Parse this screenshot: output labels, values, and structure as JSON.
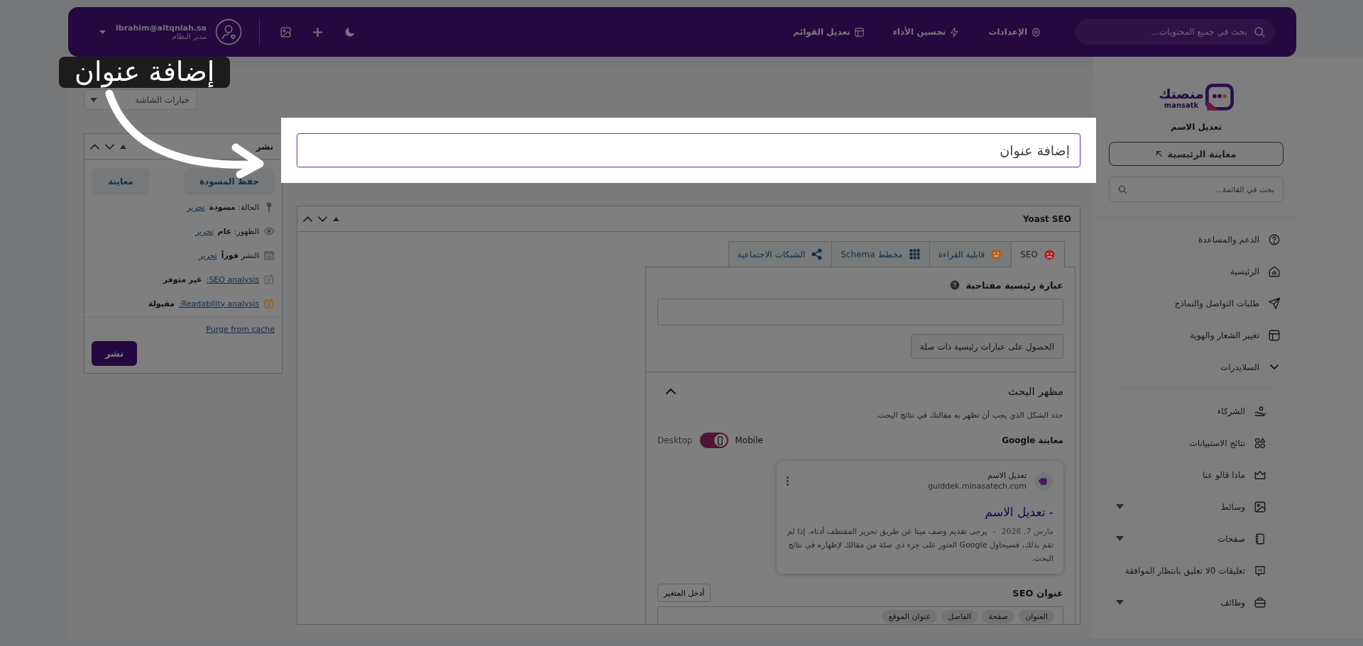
{
  "topbar": {
    "search": {
      "placeholder": "بحث في جميع المحتويات..."
    },
    "nav": [
      {
        "label": "الإعدادات"
      },
      {
        "label": "تحسين الأداء"
      },
      {
        "label": "تعديل القوائم"
      }
    ],
    "user": {
      "email": "ibrahim@altqniah.sa",
      "role": "مدير النظام"
    }
  },
  "sidebar": {
    "logo": {
      "name": "منصتك",
      "latin": "mansatk"
    },
    "site_name": "تعديل الاسم",
    "preview_button": "معاينة الرئيسية",
    "search": {
      "placeholder": "بحث في القائمة..."
    },
    "groups": [
      {
        "items": [
          {
            "label": "الدعم والمساعدة",
            "kind": "link"
          },
          {
            "label": "الرئيسية",
            "kind": "link"
          },
          {
            "label": "طلبات التواصل والنماذج",
            "kind": "link"
          },
          {
            "label": "تغيير الشعار والهوية",
            "kind": "link"
          },
          {
            "label": "السلايدرات",
            "kind": "link"
          }
        ]
      },
      {
        "items": [
          {
            "label": "الشركاء",
            "kind": "link"
          },
          {
            "label": "نتائج الاستبيانات",
            "kind": "link"
          },
          {
            "label": "ماذا قالو عنا",
            "kind": "link"
          },
          {
            "label": "وسائط",
            "kind": "submenu"
          },
          {
            "label": "صفحات",
            "kind": "submenu"
          },
          {
            "label": "تعليقات 0لا تعليق بانتظار الموافقة",
            "kind": "link"
          },
          {
            "label": "وظائف",
            "kind": "submenu"
          }
        ]
      }
    ]
  },
  "screen_options": {
    "label": "خيارات الشاشة"
  },
  "title_field": {
    "placeholder": "إضافة عنوان"
  },
  "tooltip": {
    "text": "إضافة عنوان"
  },
  "publish": {
    "title": "نشر",
    "save_draft": "حفظ المسودة",
    "preview": "معاينة",
    "rows": [
      {
        "kind": "meta",
        "text": "الحالة: **مسودة**",
        "link": "تحرير"
      },
      {
        "kind": "meta",
        "text": "الظهور: **عام**",
        "link": "تحرير"
      },
      {
        "kind": "meta",
        "text": "النشر **فوراً**",
        "link": "تحرير"
      },
      {
        "kind": "analysis",
        "link": "SEO analysis:",
        "value": "غير متوفر",
        "color": "#5a5c60"
      },
      {
        "kind": "analysis",
        "link": "Readability analysis:",
        "value": "مقبولة",
        "color": "#a3560f"
      }
    ],
    "purge_link": "Purge from cache",
    "publish_button": "نشر"
  },
  "yoast": {
    "title": "Yoast SEO",
    "tabs": [
      {
        "label": "SEO",
        "color": "#a82828",
        "selected": true
      },
      {
        "label": "قابلية القراءة",
        "color": "#b3611a",
        "selected": false
      },
      {
        "label": "مخطط Schema",
        "selected": false
      },
      {
        "label": "الشبكات الاجتماعية",
        "selected": false
      }
    ],
    "keyphrase": {
      "label": "عبارة رئيسية مفتاحية",
      "button": "الحصول على عبارات رئيسية ذات صلة"
    },
    "search_appearance": {
      "title": "مظهر البحث",
      "expanded": true,
      "description": "حدد الشكل الذي يجب أن تظهر به مقالتك في نتائج البحث.",
      "preview_label": "معاينة Google",
      "mobile_label": "Mobile",
      "desktop_label": "Desktop",
      "mobile": true,
      "preview": {
        "site_name": "تعديل الاسم",
        "url": "guiddek.minasatech.com",
        "title": "- تعديل الاسم",
        "date": "مارس 7, 2026",
        "separator": "-",
        "snippet": "يرجى تقديم وصف ميتا عن طريق تحرير المقتطف أدناه. إذا لم تقم بذلك، فسيحاول Google العثور على جزء ذي صلة من مقالك لإظهاره في نتائج البحث."
      }
    },
    "seo_title": {
      "label": "عنوان SEO",
      "button": "أدخل المتغير",
      "chips": [
        "العنوان",
        "صفحة",
        "الفاصل",
        "عنوان الموقع"
      ]
    }
  }
}
